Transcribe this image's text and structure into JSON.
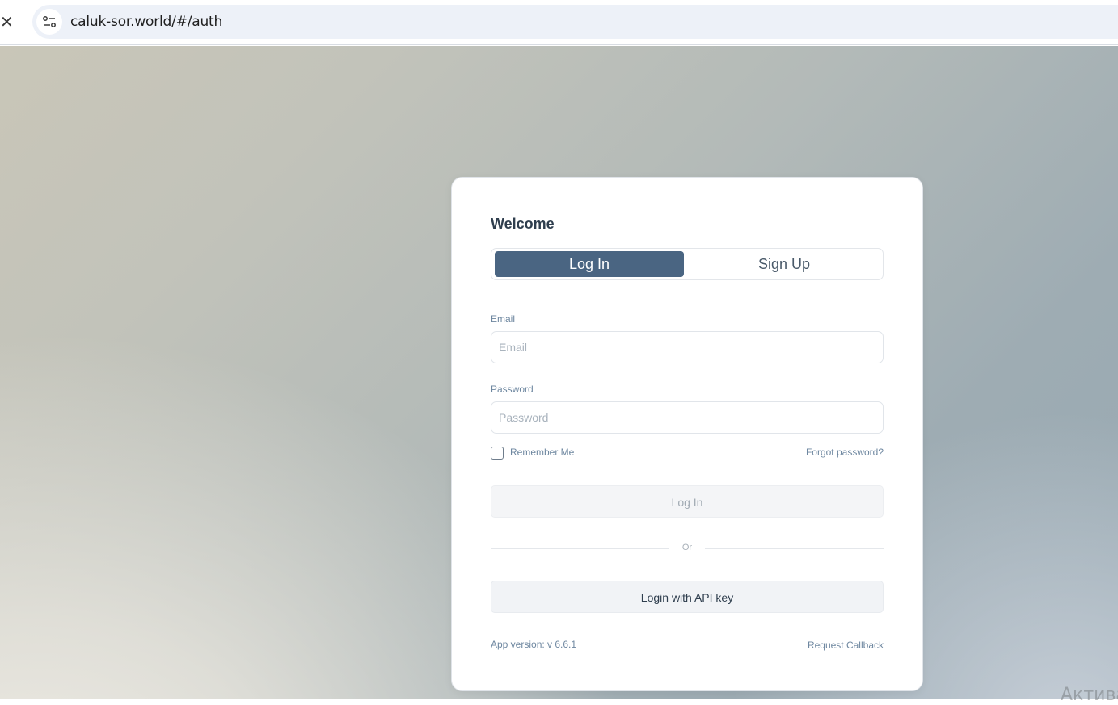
{
  "browser": {
    "url": "caluk-sor.world/#/auth",
    "close_icon": "close-icon",
    "site_info_icon": "tune-icon"
  },
  "auth": {
    "title": "Welcome",
    "tabs": [
      {
        "label": "Log In",
        "active": true
      },
      {
        "label": "Sign Up",
        "active": false
      }
    ],
    "email": {
      "label": "Email",
      "placeholder": "Email",
      "value": ""
    },
    "password": {
      "label": "Password",
      "placeholder": "Password",
      "value": ""
    },
    "remember_me": {
      "label": "Remember Me",
      "checked": false
    },
    "forgot_password": "Forgot password?",
    "login_button": "Log In",
    "divider_text": "Or",
    "api_key_button": "Login with API key",
    "app_version": "App version: v 6.6.1",
    "request_callback": "Request Callback"
  },
  "watermark": "Активац",
  "colors": {
    "accent": "#4a6582",
    "label": "#6e87a0",
    "text": "#2f3e4e"
  }
}
